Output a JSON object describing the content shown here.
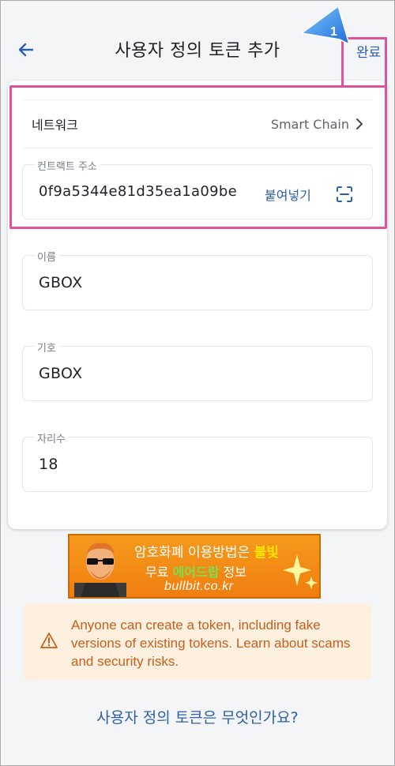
{
  "header": {
    "title": "사용자 정의 토큰 추가",
    "done_label": "완료"
  },
  "annotation": {
    "callout_number": "1"
  },
  "network": {
    "label": "네트워크",
    "value": "Smart Chain"
  },
  "fields": {
    "contract": {
      "label": "컨트랙트 주소",
      "value": "0f9a5344e81d35ea1a09be",
      "paste_label": "붙여넣기"
    },
    "name": {
      "label": "이름",
      "value": "GBOX"
    },
    "symbol": {
      "label": "기호",
      "value": "GBOX"
    },
    "decimals": {
      "label": "자리수",
      "value": "18"
    }
  },
  "banner": {
    "line1_prefix": "암호화폐 이용방법은 ",
    "line1_highlight": "불빛",
    "line2_prefix": "무료 ",
    "line2_highlight": "에어드랍",
    "line2_suffix": " 정보",
    "line3": "bullbit.co.kr"
  },
  "warning": {
    "text": "Anyone can create a token, including fake versions of existing tokens. Learn about scams and security risks."
  },
  "faq_link": "사용자 정의 토큰은 무엇인가요?",
  "colors": {
    "accent": "#2d5fa8",
    "annotation": "#e0529a",
    "warning_bg": "#fdf0de",
    "warning_text": "#c85e1c",
    "banner": "#f07e10"
  }
}
